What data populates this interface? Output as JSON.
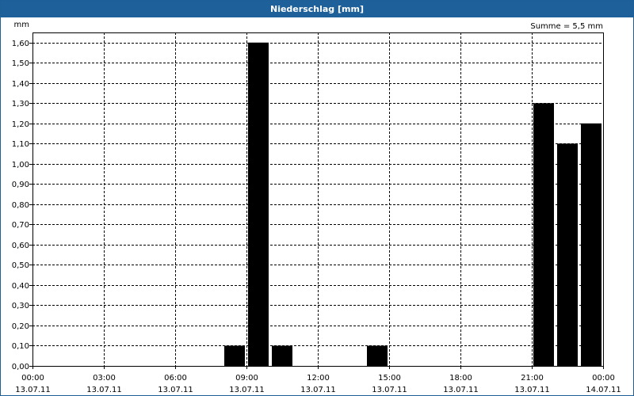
{
  "window": {
    "title": "Niederschlag [mm]"
  },
  "chart_data": {
    "type": "bar",
    "ylabel": "mm",
    "sum_label": "Summe = 5,5 mm",
    "ylim": [
      0,
      1.65
    ],
    "y_ticks": [
      0,
      0.1,
      0.2,
      0.3,
      0.4,
      0.5,
      0.6,
      0.7,
      0.8,
      0.9,
      1.0,
      1.1,
      1.2,
      1.3,
      1.4,
      1.5,
      1.6
    ],
    "y_tick_labels": [
      "0,00",
      "0,10",
      "0,20",
      "0,30",
      "0,40",
      "0,50",
      "0,60",
      "0,70",
      "0,80",
      "0,90",
      "1,00",
      "1,10",
      "1,20",
      "1,30",
      "1,40",
      "1,50",
      "1,60"
    ],
    "x_range_hours": [
      0,
      24
    ],
    "x_ticks_hours": [
      0,
      3,
      6,
      9,
      12,
      15,
      18,
      21,
      24
    ],
    "x_tick_labels": [
      {
        "time": "00:00",
        "date": "13.07.11"
      },
      {
        "time": "03:00",
        "date": "13.07.11"
      },
      {
        "time": "06:00",
        "date": "13.07.11"
      },
      {
        "time": "09:00",
        "date": "13.07.11"
      },
      {
        "time": "12:00",
        "date": "13.07.11"
      },
      {
        "time": "15:00",
        "date": "13.07.11"
      },
      {
        "time": "18:00",
        "date": "13.07.11"
      },
      {
        "time": "21:00",
        "date": "13.07.11"
      },
      {
        "time": "00:00",
        "date": "14.07.11"
      }
    ],
    "bar_interval_hours": 1,
    "bars": [
      {
        "hour_start": 8,
        "value": 0.1
      },
      {
        "hour_start": 9,
        "value": 1.6
      },
      {
        "hour_start": 10,
        "value": 0.1
      },
      {
        "hour_start": 14,
        "value": 0.1
      },
      {
        "hour_start": 21,
        "value": 1.3
      },
      {
        "hour_start": 22,
        "value": 1.1
      },
      {
        "hour_start": 23,
        "value": 1.2
      }
    ],
    "grid": true,
    "bar_color": "#000000"
  }
}
